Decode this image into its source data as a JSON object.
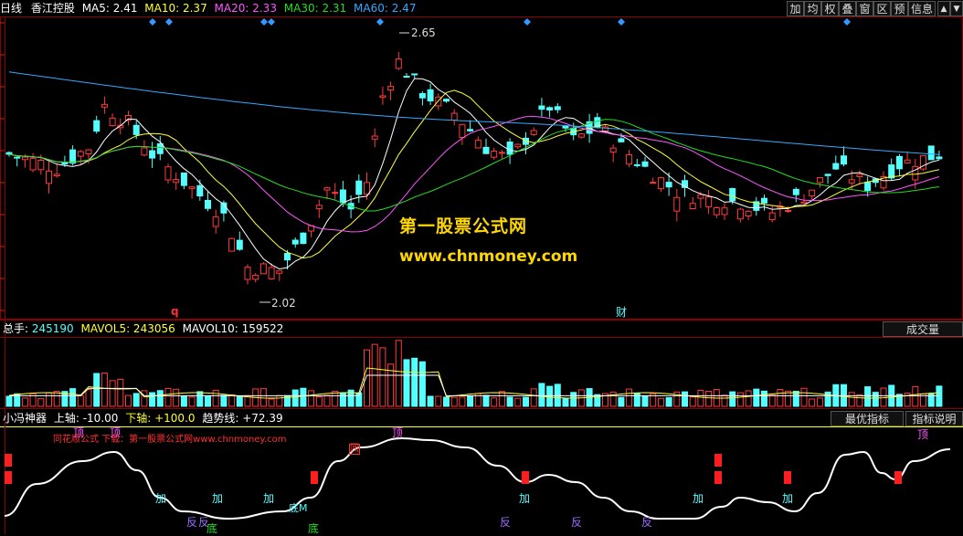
{
  "colors": {
    "up": "#ff3b3b",
    "down": "#54ffff",
    "ma5": "#ffffff",
    "ma10": "#ffff33",
    "ma20": "#ff55ff",
    "ma30": "#22dd22",
    "ma60": "#33aaff",
    "grid": "#8b0000",
    "accent": "#ffd700",
    "signal_red": "#ff1e1e"
  },
  "header": {
    "period": "日线",
    "stock_name": "香江控股",
    "ma5_label": "MA5: 2.41",
    "ma10_label": "MA10: 2.37",
    "ma20_label": "MA20: 2.33",
    "ma30_label": "MA30: 2.31",
    "ma60_label": "MA60: 2.47"
  },
  "toolbar": {
    "buttons": [
      "加",
      "均",
      "权",
      "叠",
      "窗",
      "区",
      "预",
      "信息"
    ]
  },
  "price_chart": {
    "high_label": "2.65",
    "low_label": "2.02",
    "marker_q": "q",
    "marker_cai": "财"
  },
  "watermark": {
    "line1": "第一股票公式网",
    "line2": "www.chnmoney.com"
  },
  "volume_panel": {
    "total_label": "总手:",
    "total_value": "245190",
    "mavol5_label": "MAVOL5: 243056",
    "mavol10_label": "MAVOL10: 159522",
    "tab_label": "成交量"
  },
  "indicator_panel": {
    "name": "小冯神器",
    "upper_label": "上轴:",
    "upper_value": "-10.00",
    "lower_label": "下轴:",
    "lower_value": "+100.0",
    "trend_label": "趋势线:",
    "trend_value": "+72.39",
    "best_button": "最优指标",
    "help_button": "指标说明",
    "promo_text": "同花顺公式 下载：第一股票公式网www.chnmoney.com",
    "labels": {
      "ding": "顶",
      "jia": "加",
      "di": "底",
      "fan": "反",
      "hui": "回",
      "dim": "底M"
    }
  },
  "chart_data": {
    "type": "candlestick",
    "price_ylim": [
      1.95,
      2.75
    ],
    "high": 2.65,
    "low": 2.02,
    "ma_values": {
      "MA5": 2.41,
      "MA10": 2.37,
      "MA20": 2.33,
      "MA30": 2.31,
      "MA60": 2.47
    },
    "volume": {
      "total": 245190,
      "MAVOL5": 243056,
      "MAVOL10": 159522
    },
    "indicator": {
      "upper_axis": -10.0,
      "lower_axis": 100.0,
      "trend_line": 72.39
    }
  }
}
